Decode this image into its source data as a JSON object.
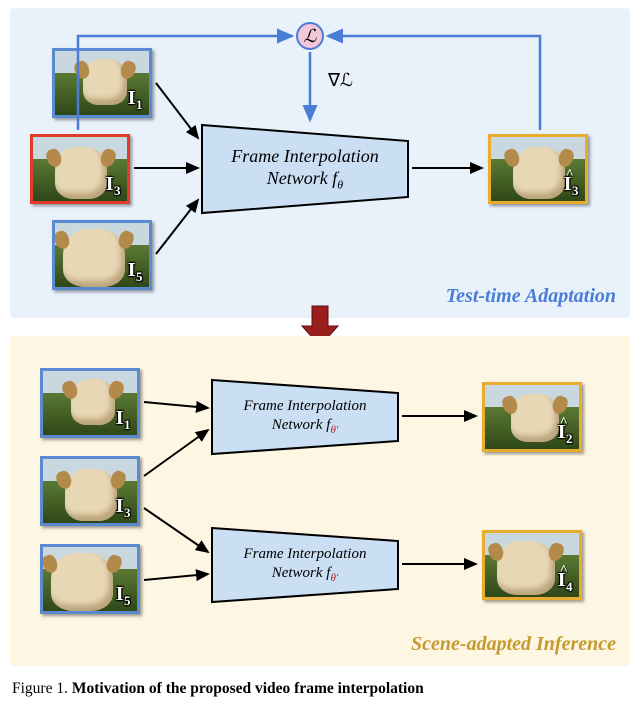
{
  "top": {
    "title": "Test-time Adaptation",
    "frames": {
      "i1": "I",
      "i1_sub": "1",
      "i3": "I",
      "i3_sub": "3",
      "i5": "I",
      "i5_sub": "5",
      "ihat3": "I",
      "ihat3_sub": "3"
    },
    "net_line1": "Frame Interpolation",
    "net_line2": "Network f",
    "net_param": "θ",
    "loss_symbol": "ℒ",
    "grad_label": "∇ℒ"
  },
  "bottom": {
    "title": "Scene-adapted Inference",
    "frames": {
      "i1": "I",
      "i1_sub": "1",
      "i3": "I",
      "i3_sub": "3",
      "i5": "I",
      "i5_sub": "5",
      "ihat2": "I",
      "ihat2_sub": "2",
      "ihat4": "I",
      "ihat4_sub": "4"
    },
    "net_line1": "Frame Interpolation",
    "net_line2": "Network  f",
    "net_param": "θ′"
  },
  "caption_prefix": "Figure 1. ",
  "caption_bold": "Motivation of the proposed video frame interpolation"
}
